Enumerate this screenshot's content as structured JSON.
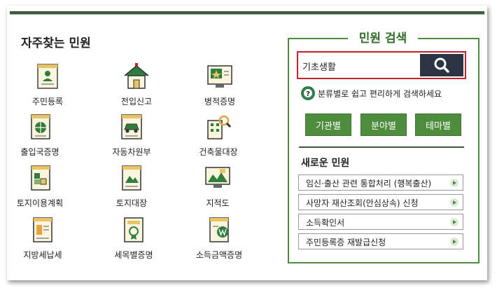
{
  "frequent": {
    "title": "자주찾는 민원",
    "items": [
      {
        "label": "주민등록",
        "icon": "resident-registration-icon"
      },
      {
        "label": "전입신고",
        "icon": "house-icon"
      },
      {
        "label": "병적증명",
        "icon": "military-certificate-icon"
      },
      {
        "label": "출입국증명",
        "icon": "immigration-globe-icon"
      },
      {
        "label": "자동차원부",
        "icon": "car-document-icon"
      },
      {
        "label": "건축물대장",
        "icon": "building-search-icon"
      },
      {
        "label": "토지이용계획",
        "icon": "land-plan-icon"
      },
      {
        "label": "토지대장",
        "icon": "land-ledger-icon"
      },
      {
        "label": "지적도",
        "icon": "cadastral-map-icon"
      },
      {
        "label": "지방세납세",
        "icon": "local-tax-icon"
      },
      {
        "label": "세목별증명",
        "icon": "tax-item-icon"
      },
      {
        "label": "소득금액증명",
        "icon": "income-won-icon"
      }
    ]
  },
  "search": {
    "title": "민원 검색",
    "value": "기초생활",
    "hint": "분류별로 쉽고 편리하게 검색하세요",
    "categories": [
      "기관별",
      "분야별",
      "테마별"
    ]
  },
  "new_services": {
    "title": "새로운 민원",
    "items": [
      "임신·출산 관련 통합처리 (행복출산)",
      "사망자 재산조회(안심상속) 신청",
      "소득확인서",
      "주민등록증 재발급신청"
    ]
  },
  "colors": {
    "accent_green": "#4d8d3d",
    "highlight_red": "#c3202e",
    "search_button": "#2b3442"
  }
}
